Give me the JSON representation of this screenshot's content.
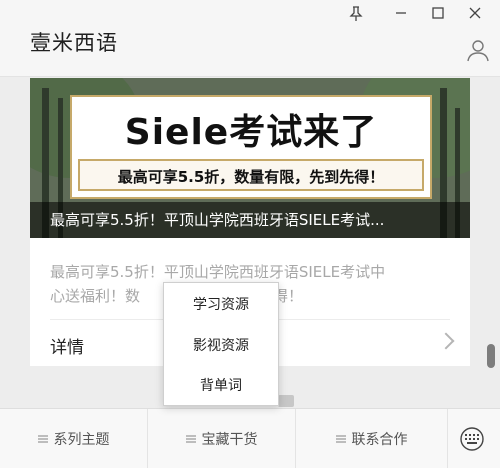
{
  "app": {
    "title": "壹米西语"
  },
  "window_controls": [
    {
      "name": "pin",
      "glyph": "⚲"
    },
    {
      "name": "minimize",
      "glyph": "—"
    },
    {
      "name": "maximize",
      "glyph": "☐"
    },
    {
      "name": "close",
      "glyph": "✕"
    }
  ],
  "icons": {
    "avatar": "person-icon",
    "keyboard": "keyboard-icon",
    "chevron": "chevron-right-icon",
    "menu": "menu-icon"
  },
  "article": {
    "banner_headline": "Siele考试来了",
    "banner_sub": "最高可享5.5折，数量有限，先到先得！",
    "banner_caption": "最高可享5.5折！平顶山学院西班牙语SIELE考试...",
    "description_line1": "最高可享5.5折！平顶山学院西班牙语SIELE考试中",
    "description_line2_left": "心送福利！数",
    "description_line2_right": "先得！",
    "detail_label": "详情"
  },
  "popup_menu": {
    "items": [
      "学习资源",
      "影视资源",
      "背单词"
    ]
  },
  "bottom_nav": {
    "items": [
      "系列主题",
      "宝藏干货",
      "联系合作"
    ]
  },
  "colors": {
    "accent_gold": "#c6a969",
    "text_muted": "#a8a8a8",
    "nav_bg": "#f8f8f8"
  }
}
